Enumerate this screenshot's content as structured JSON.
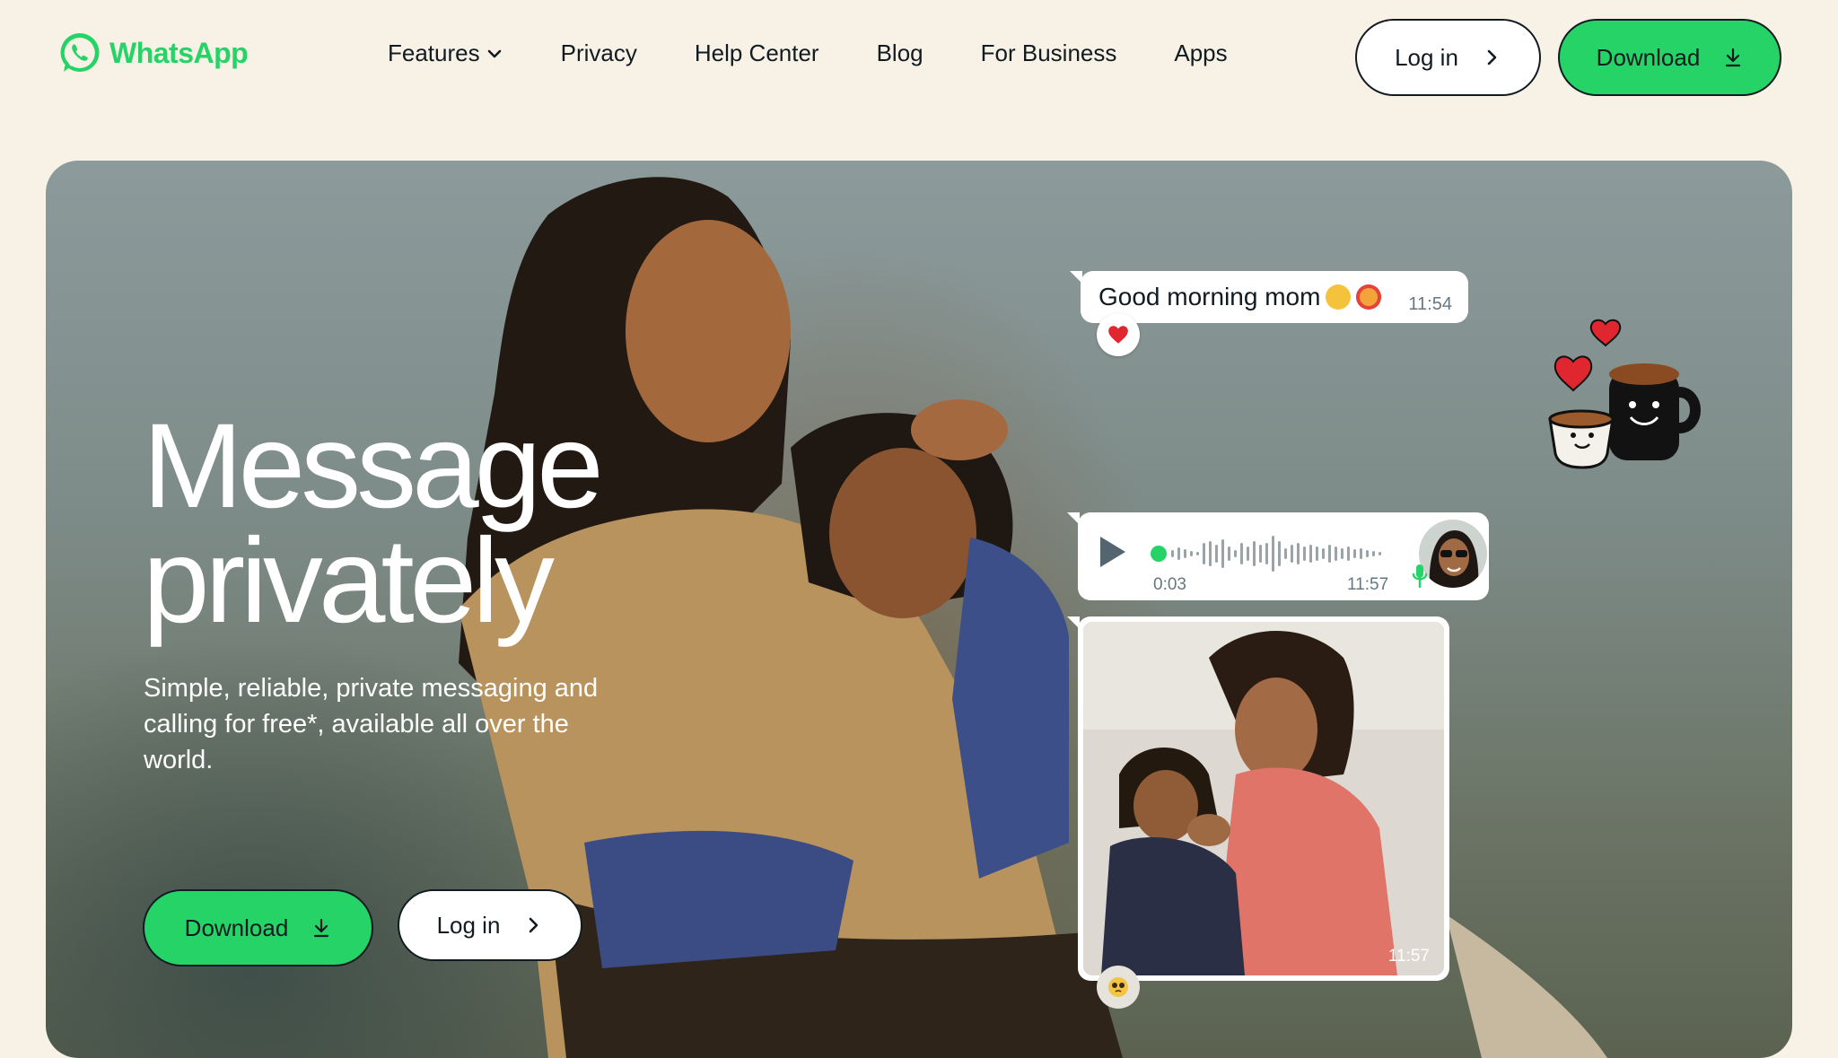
{
  "brand": {
    "name": "WhatsApp",
    "color": "#25d366"
  },
  "nav": {
    "links": [
      "Features",
      "Privacy",
      "Help Center",
      "Blog",
      "For Business",
      "Apps"
    ],
    "login_label": "Log in",
    "download_label": "Download"
  },
  "hero": {
    "title_line1": "Message",
    "title_line2": "privately",
    "subtitle": "Simple, reliable, private messaging and calling for free*, available all over the world.",
    "download_label": "Download",
    "login_label": "Log in"
  },
  "chat": {
    "message_text": "Good morning mom",
    "message_time": "11:54",
    "message_reaction": "heart",
    "voice_duration": "0:03",
    "voice_time": "11:57",
    "photo_time": "11:57",
    "photo_reaction": "pleading-face"
  },
  "icons": {
    "features_dropdown": "chevron-down-icon",
    "login": "chevron-right-icon",
    "download": "download-arrow-icon"
  },
  "colors": {
    "page_background": "#f8f2e6",
    "accent_green": "#25d366",
    "text_dark": "#111b21",
    "bubble_white": "#ffffff",
    "meta_grey": "#667781"
  }
}
